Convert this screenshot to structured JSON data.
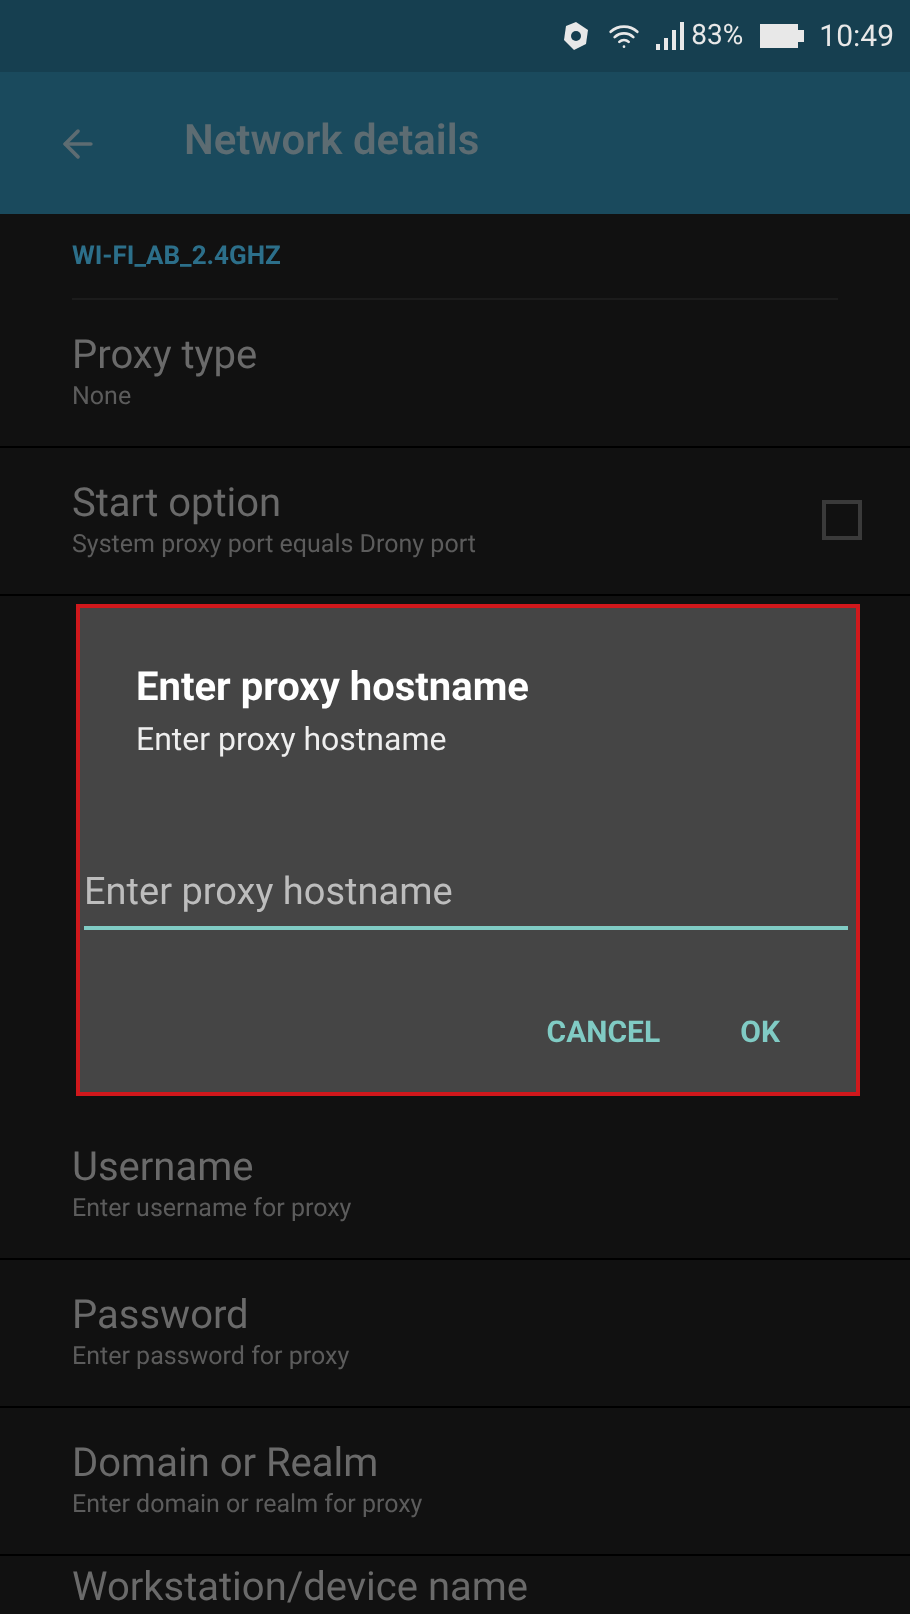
{
  "status_bar": {
    "battery": "83%",
    "time": "10:49"
  },
  "app_bar": {
    "title": "Network details"
  },
  "section_header": "WI-FI_AB_2.4GHZ",
  "settings": [
    {
      "kind": "text",
      "title": "Proxy type",
      "summary": "None"
    },
    {
      "kind": "checkbox",
      "title": "Start option",
      "summary": "System proxy port equals Drony port",
      "checked": false
    },
    {
      "kind": "spacer"
    },
    {
      "kind": "text",
      "title": "Username",
      "summary": "Enter username for proxy"
    },
    {
      "kind": "text",
      "title": "Password",
      "summary": "Enter password for proxy"
    },
    {
      "kind": "text",
      "title": "Domain or Realm",
      "summary": "Enter domain or realm for proxy"
    },
    {
      "kind": "text",
      "title": "Workstation/device name"
    }
  ],
  "dialog": {
    "title": "Enter proxy hostname",
    "message": "Enter proxy hostname",
    "placeholder": "Enter proxy hostname",
    "buttons": [
      "CANCEL",
      "OK"
    ]
  }
}
